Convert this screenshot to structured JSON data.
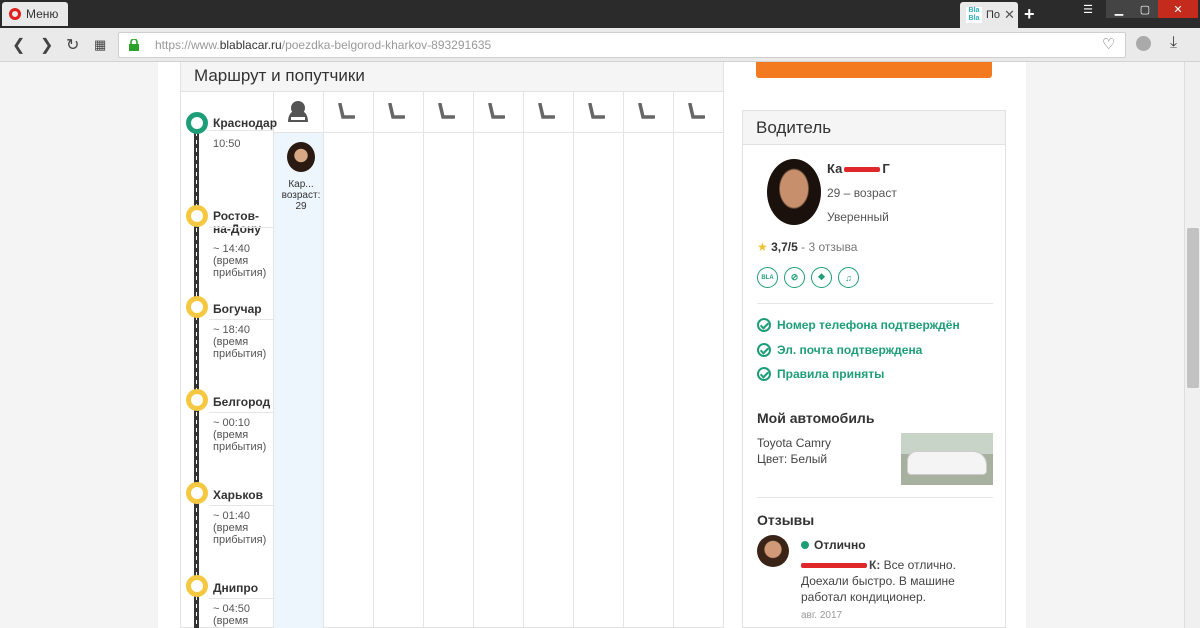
{
  "browser": {
    "menu_label": "Меню",
    "tab_title": "По",
    "tab_favicon_text": "Bla Bla",
    "url_prefix": "https://www.",
    "url_domain": "blablacar.ru",
    "url_path": "/poezdka-belgorod-kharkov-893291635"
  },
  "route": {
    "title": "Маршрут и попутчики",
    "stops": [
      {
        "name": "Краснодар",
        "time": "10:50",
        "note": ""
      },
      {
        "name": "Ростов-на-Дону",
        "time": "~ 14:40",
        "note": "(время прибытия)"
      },
      {
        "name": "Богучар",
        "time": "~ 18:40",
        "note": "(время прибытия)"
      },
      {
        "name": "Белгород",
        "time": "~ 00:10",
        "note": "(время прибытия)"
      },
      {
        "name": "Харьков",
        "time": "~ 01:40",
        "note": "(время прибытия)"
      },
      {
        "name": "Днипро",
        "time": "~ 04:50",
        "note": "(время"
      }
    ],
    "rider": {
      "name": "Кар...",
      "age_label": "возраст:",
      "age": "29"
    }
  },
  "driver": {
    "section_title": "Водитель",
    "name_start": "Ка",
    "name_end": "Г",
    "age": "29 – возраст",
    "experience": "Уверенный",
    "rating": "3,7/5",
    "reviews_count": "- 3 отзыва",
    "prefs": [
      "BLA",
      "no-smoking-icon",
      "pets-icon",
      "music-icon"
    ],
    "verifications": [
      "Номер телефона подтверждён",
      "Эл. почта подтверждена",
      "Правила приняты"
    ]
  },
  "car": {
    "title": "Мой автомобиль",
    "model": "Toyota Camry",
    "color": "Цвет: Белый"
  },
  "reviews": {
    "title": "Отзывы",
    "items": [
      {
        "rating_label": "Отлично",
        "author_end": "К:",
        "text": "Все отлично. Доехали быстро. В машине работал кондиционер.",
        "date": "авг. 2017"
      }
    ]
  },
  "colors": {
    "accent_green": "#1e9e78",
    "stop_yellow": "#f5c842",
    "orange": "#f47a20",
    "redaction": "#e0282a"
  }
}
